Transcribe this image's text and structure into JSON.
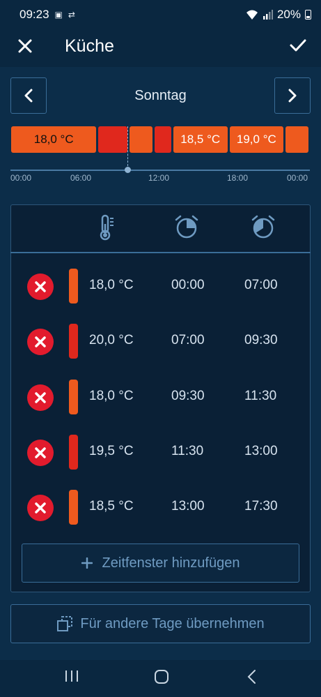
{
  "status_bar": {
    "time": "09:23",
    "battery": "20%",
    "icons": [
      "notification-icon",
      "data-saver-icon",
      "wifi-icon",
      "signal-icon",
      "battery-icon"
    ]
  },
  "header": {
    "title": "Küche",
    "close_icon": "close-icon",
    "confirm_icon": "check-icon"
  },
  "day_selector": {
    "day": "Sonntag"
  },
  "timeline": {
    "segments": [
      {
        "label": "18,0 °C",
        "start": "00:00",
        "end": "07:00",
        "color": "#ee5a1e"
      },
      {
        "label": "",
        "start": "07:00",
        "end": "09:30",
        "color": "#e0281d"
      },
      {
        "label": "",
        "start": "09:30",
        "end": "11:30",
        "color": "#ee5a1e"
      },
      {
        "label": "",
        "start": "11:30",
        "end": "13:00",
        "color": "#e0281d"
      },
      {
        "label": "18,5 °C",
        "start": "13:00",
        "end": "17:30",
        "color": "#ee5a1e"
      },
      {
        "label": "19,0 °C",
        "start": "17:30",
        "end": "22:00",
        "color": "#ee5a1e"
      },
      {
        "label": "",
        "start": "22:00",
        "end": "24:00",
        "color": "#ee5a1e"
      }
    ],
    "ticks": [
      "00:00",
      "06:00",
      "12:00",
      "18:00",
      "00:00"
    ],
    "current_time": "09:23"
  },
  "table": {
    "header_icons": [
      "thermometer-icon",
      "start-alarm-icon",
      "end-alarm-icon"
    ],
    "rows": [
      {
        "temp": "18,0 °C",
        "start": "00:00",
        "end": "07:00",
        "color": "#ee5a1e"
      },
      {
        "temp": "20,0 °C",
        "start": "07:00",
        "end": "09:30",
        "color": "#e0281d"
      },
      {
        "temp": "18,0 °C",
        "start": "09:30",
        "end": "11:30",
        "color": "#ee5a1e"
      },
      {
        "temp": "19,5 °C",
        "start": "11:30",
        "end": "13:00",
        "color": "#e0281d"
      },
      {
        "temp": "18,5 °C",
        "start": "13:00",
        "end": "17:30",
        "color": "#ee5a1e"
      }
    ]
  },
  "add_button": {
    "label": "Zeitfenster hinzufügen",
    "icon": "plus-icon"
  },
  "copy_button": {
    "label": "Für andere Tage übernehmen",
    "icon": "copy-icon"
  },
  "colors": {
    "orange": "#ee5a1e",
    "red": "#e0281d",
    "delete": "#e21b2d",
    "accent": "#3a6d98"
  }
}
